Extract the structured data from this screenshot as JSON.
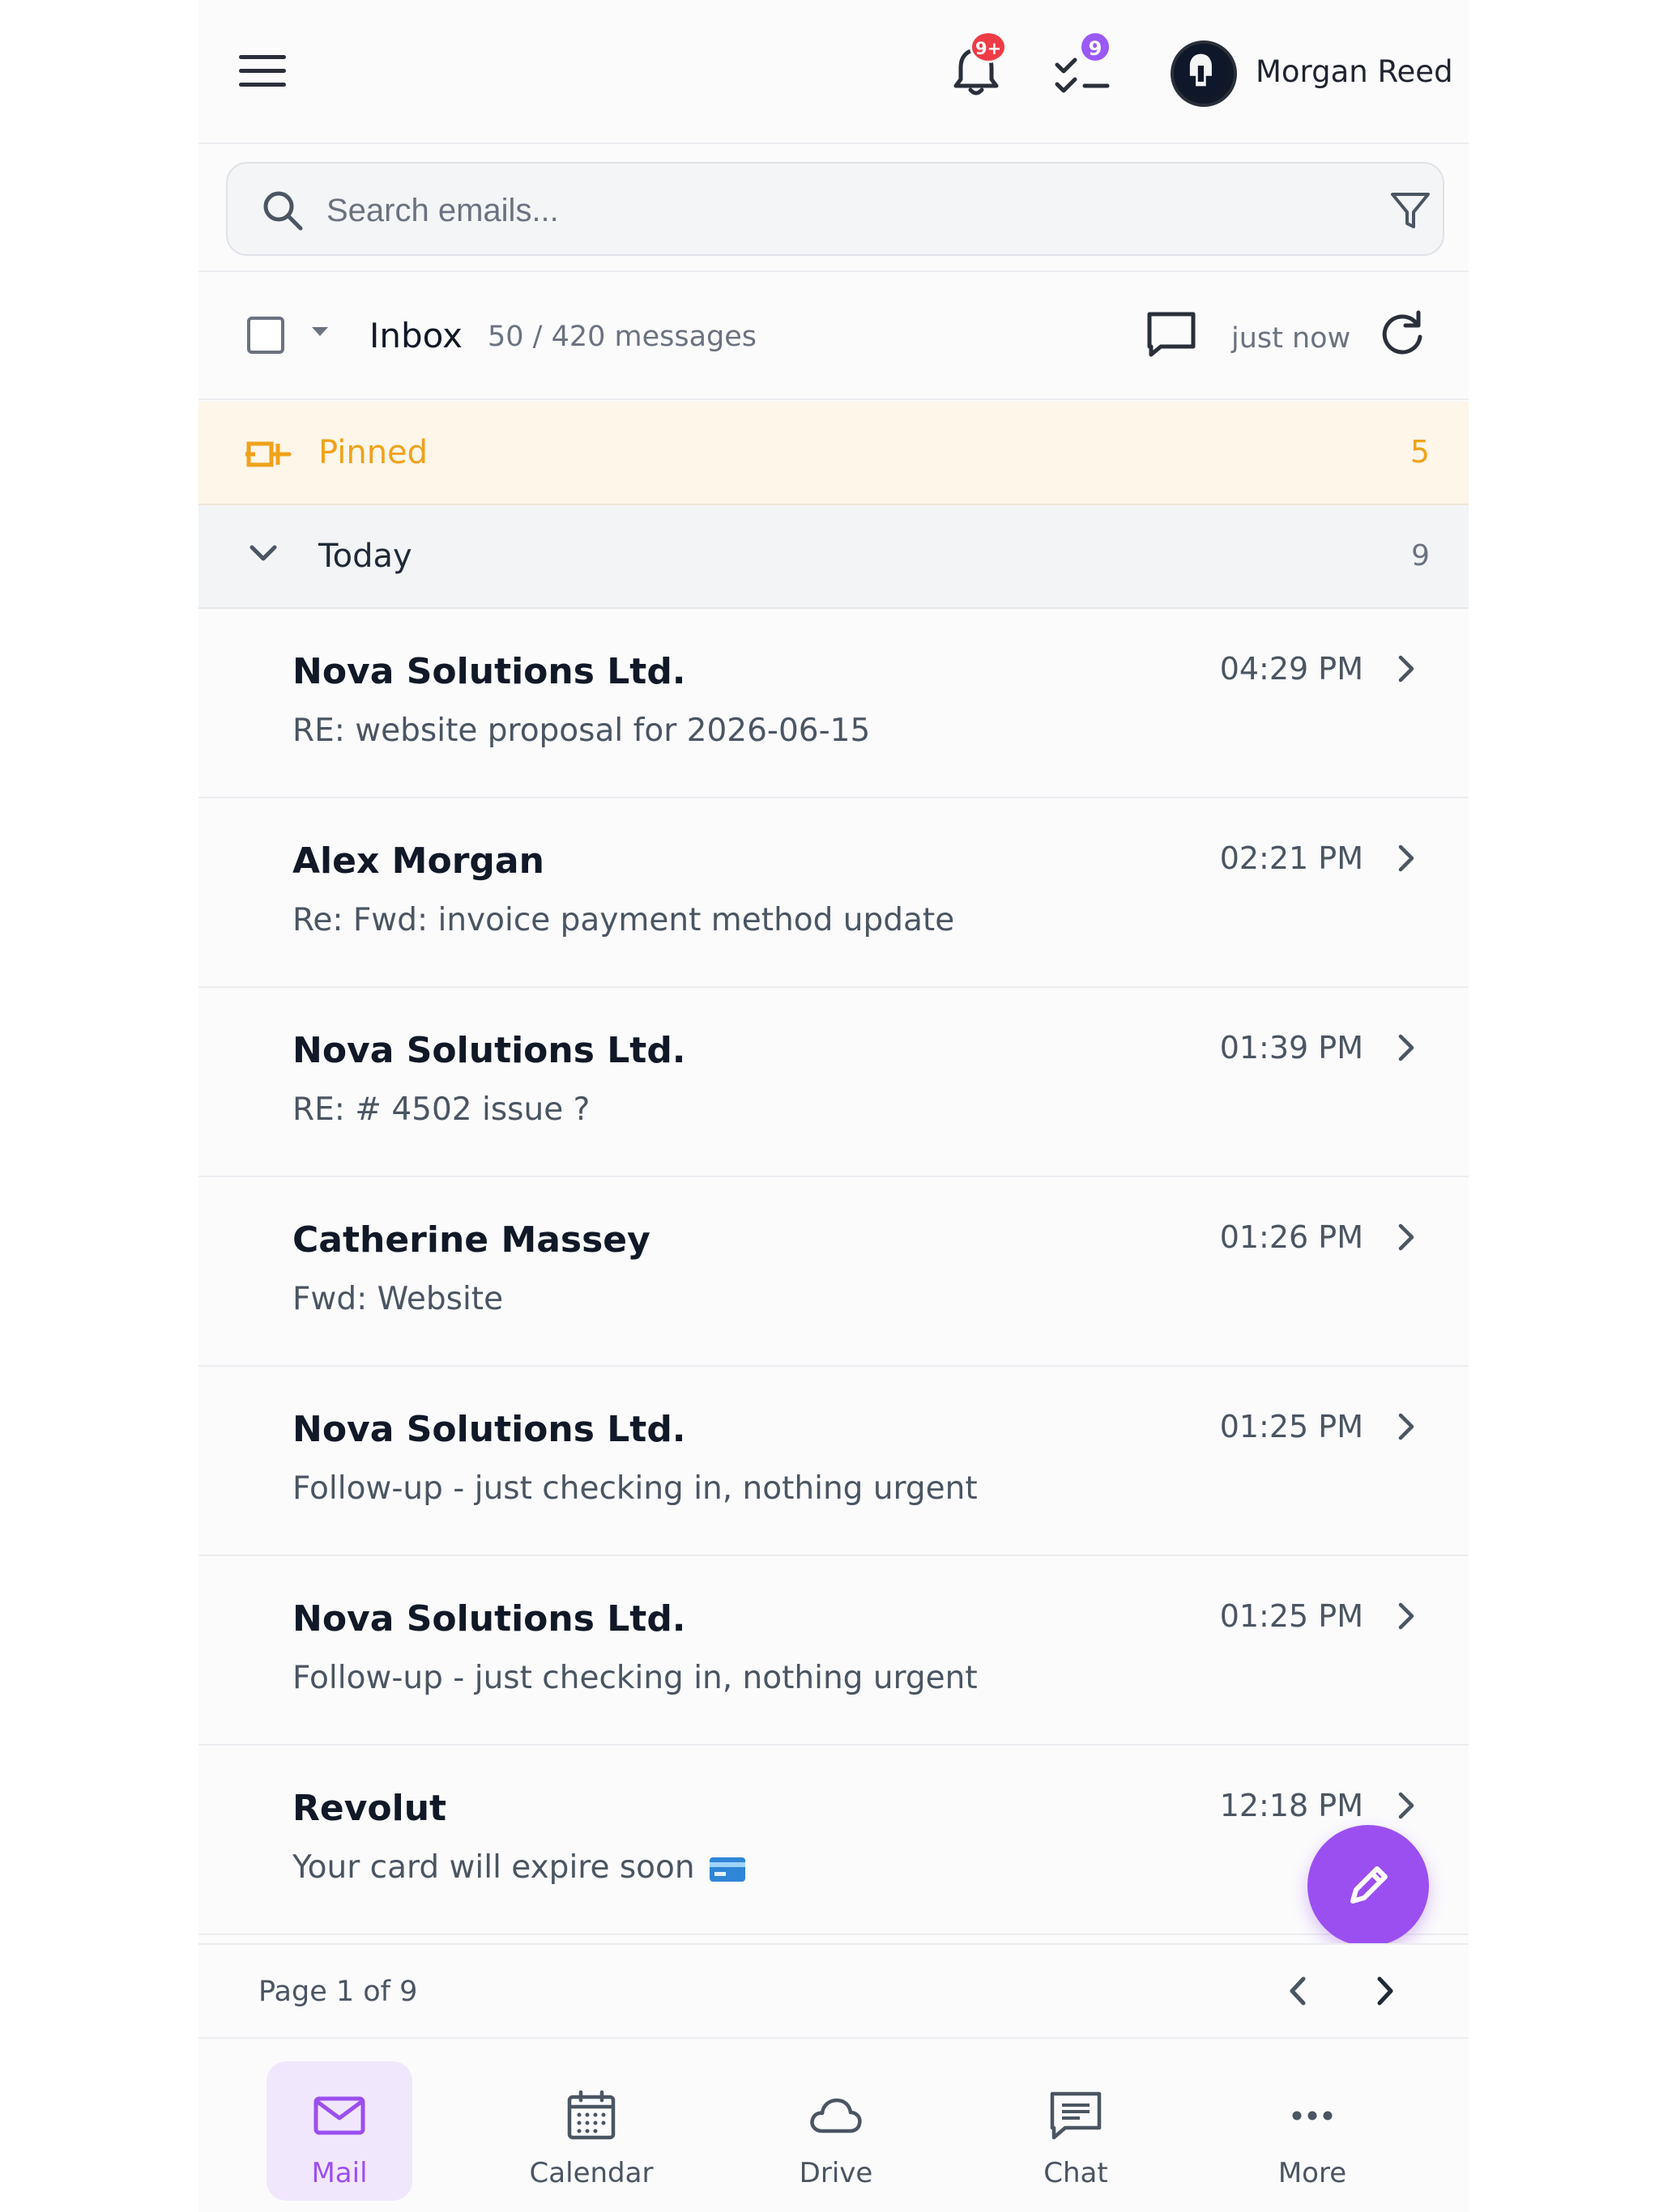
{
  "header": {
    "user_name": "Morgan Reed",
    "notifications_badge": "9+",
    "tasks_badge": "9"
  },
  "search": {
    "placeholder": "Search emails..."
  },
  "toolbar": {
    "folder": "Inbox",
    "message_count": "50 / 420 messages",
    "updated": "just now"
  },
  "pinned": {
    "label": "Pinned",
    "count": "5"
  },
  "today": {
    "label": "Today",
    "count": "9"
  },
  "emails": [
    {
      "sender": "Nova Solutions Ltd.",
      "subject": "RE: website proposal for 2026-06-15",
      "time": "04:29 PM"
    },
    {
      "sender": "Alex Morgan",
      "subject": "Re: Fwd: invoice payment method update",
      "time": "02:21 PM"
    },
    {
      "sender": "Nova Solutions Ltd.",
      "subject": "RE: # 4502 issue ?",
      "time": "01:39 PM"
    },
    {
      "sender": "Catherine Massey",
      "subject": "Fwd: Website",
      "time": "01:26 PM"
    },
    {
      "sender": "Nova Solutions Ltd.",
      "subject": "Follow-up - just checking in, nothing urgent",
      "time": "01:25 PM"
    },
    {
      "sender": "Nova Solutions Ltd.",
      "subject": "Follow-up - just checking in, nothing urgent",
      "time": "01:25 PM"
    },
    {
      "sender": "Revolut",
      "subject": "Your card will expire soon",
      "time": "12:18 PM"
    }
  ],
  "pagination": {
    "label": "Page 1 of 9"
  },
  "nav": [
    {
      "label": "Mail",
      "icon": "mail-icon"
    },
    {
      "label": "Calendar",
      "icon": "calendar-icon"
    },
    {
      "label": "Drive",
      "icon": "cloud-icon"
    },
    {
      "label": "Chat",
      "icon": "chat-icon"
    },
    {
      "label": "More",
      "icon": "more-icon"
    }
  ],
  "colors": {
    "accent": "#9b4ff0",
    "pinned": "#f0a21a",
    "badge_red": "#ef3b46"
  }
}
